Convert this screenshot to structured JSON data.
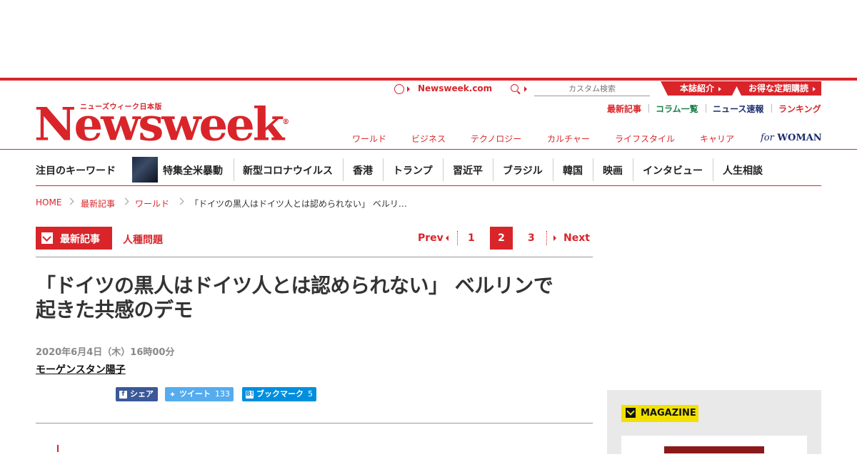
{
  "header": {
    "logo_sub": "ニューズウィーク日本版",
    "logo": "Newsweek",
    "site_link": "Newsweek.com",
    "search_placeholder": "カスタム検索",
    "tab_about": "本誌紹介",
    "tab_subscribe": "お得な定期購読",
    "util_links": [
      "最新記事",
      "コラム一覧",
      "ニュース速報",
      "ランキング"
    ],
    "categories": [
      "ワールド",
      "ビジネス",
      "テクノロジー",
      "カルチャー",
      "ライフスタイル",
      "キャリア"
    ],
    "for_woman_for": "for",
    "for_woman": "WOMAN"
  },
  "keywords": {
    "title": "注目のキーワード",
    "items": [
      "特集全米暴動",
      "新型コロナウイルス",
      "香港",
      "トランプ",
      "習近平",
      "ブラジル",
      "韓国",
      "映画",
      "インタビュー",
      "人生相談"
    ]
  },
  "breadcrumb": [
    "HOME",
    "最新記事",
    "ワールド",
    "「ドイツの黒人はドイツ人とは認められない」 ベルリ…"
  ],
  "section": {
    "badge": "最新記事",
    "tag": "人種問題"
  },
  "pagination": {
    "prev": "Prev",
    "pages": [
      "1",
      "2",
      "3"
    ],
    "current": "2",
    "next": "Next"
  },
  "article": {
    "title_line1": "「ドイツの黒人はドイツ人とは認められない」 ベルリンで",
    "title_line2": "起きた共感のデモ",
    "date": "2020年6月4日（木）16時00分",
    "author": "モーゲンスタン陽子"
  },
  "share": {
    "facebook": "シェア",
    "twitter": "ツイート",
    "twitter_count": "133",
    "hatena": "ブックマーク",
    "hatena_count": "5"
  },
  "sidebar": {
    "magazine": "MAGAZINE"
  },
  "colors": {
    "brand_red": "#d9252a",
    "facebook": "#3b5998",
    "twitter": "#55acee",
    "hatena": "#008fde",
    "magazine_yellow": "#f2e100"
  }
}
